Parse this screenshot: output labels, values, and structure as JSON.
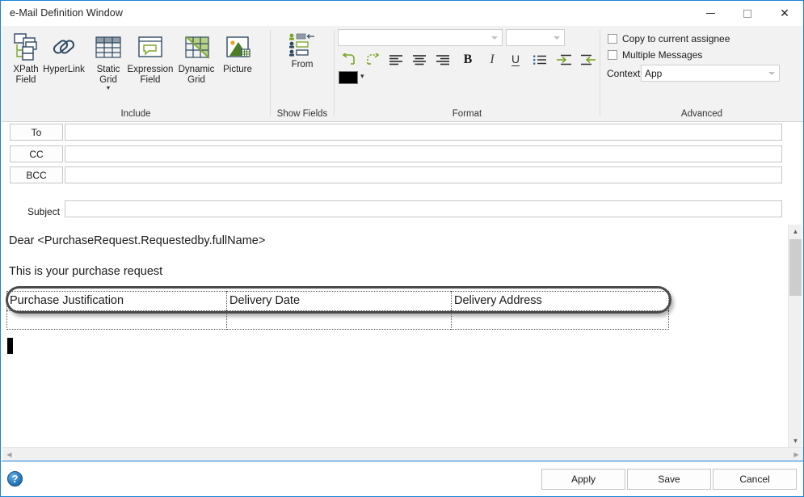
{
  "window": {
    "title": "e-Mail Definition Window",
    "controls": {
      "minimize": "minimize-button",
      "maximize": "maximize-button",
      "close": "close-button",
      "close_glyph": "✕"
    }
  },
  "ribbon": {
    "groups": [
      {
        "key": "include",
        "label": "Include"
      },
      {
        "key": "show_fields",
        "label": "Show Fields"
      },
      {
        "key": "format",
        "label": "Format"
      },
      {
        "key": "advanced",
        "label": "Advanced"
      }
    ],
    "include": {
      "buttons": [
        {
          "icon": "xpath-field-icon",
          "line1": "XPath",
          "line2": "Field",
          "has_menu": false
        },
        {
          "icon": "hyperlink-icon",
          "line1": "HyperLink",
          "line2": "",
          "has_menu": false
        },
        {
          "icon": "static-grid-icon",
          "line1": "Static",
          "line2": "Grid",
          "has_menu": true
        },
        {
          "icon": "expression-field-icon",
          "line1": "Expression",
          "line2": "Field",
          "has_menu": false
        },
        {
          "icon": "dynamic-grid-icon",
          "line1": "Dynamic",
          "line2": "Grid",
          "has_menu": false
        },
        {
          "icon": "picture-icon",
          "line1": "Picture",
          "line2": "",
          "has_menu": false
        }
      ]
    },
    "show_fields": {
      "from": {
        "icon": "from-field-icon",
        "label": "From"
      }
    },
    "format": {
      "font_family": {
        "value": "",
        "placeholder": ""
      },
      "font_size": {
        "value": "",
        "placeholder": ""
      },
      "buttons": [
        {
          "name": "undo-button",
          "glyph": "↩"
        },
        {
          "name": "redo-button",
          "glyph": "↪"
        },
        {
          "name": "align-left-button",
          "glyph": "align-left-icon"
        },
        {
          "name": "align-center-button",
          "glyph": "align-center-icon"
        },
        {
          "name": "align-right-button",
          "glyph": "align-right-icon"
        },
        {
          "name": "bold-button",
          "glyph": "B"
        },
        {
          "name": "italic-button",
          "glyph": "I"
        },
        {
          "name": "underline-button",
          "glyph": "U"
        },
        {
          "name": "bullet-list-button",
          "glyph": "bullet-list-icon"
        },
        {
          "name": "indent-increase-button",
          "glyph": "indent-increase-icon"
        },
        {
          "name": "indent-decrease-button",
          "glyph": "indent-decrease-icon"
        }
      ],
      "color_swatch": "#000000",
      "color_dropdown_glyph": "▾"
    },
    "advanced": {
      "copy_to_assignee": {
        "label": "Copy to current assignee",
        "checked": false
      },
      "multiple_messages": {
        "label": "Multiple Messages",
        "checked": false
      },
      "context": {
        "label": "Context",
        "value": "App"
      }
    }
  },
  "address": {
    "to": {
      "button": "To",
      "value": ""
    },
    "cc": {
      "button": "CC",
      "value": ""
    },
    "bcc": {
      "button": "BCC",
      "value": ""
    },
    "subject": {
      "label": "Subject",
      "value": ""
    }
  },
  "body": {
    "lines": [
      "Dear <PurchaseRequest.Requestedby.fullName>",
      "This is your purchase request"
    ],
    "grid": {
      "headers": [
        "Purchase Justification",
        "Delivery Date",
        "Delivery Address"
      ],
      "rows": [
        [
          "",
          "",
          ""
        ]
      ],
      "highlighted": true
    }
  },
  "footer": {
    "help": "?",
    "buttons": [
      {
        "name": "apply-button",
        "label": "Apply"
      },
      {
        "name": "save-button",
        "label": "Save"
      },
      {
        "name": "cancel-button",
        "label": "Cancel"
      }
    ]
  },
  "colors": {
    "accent": "#1883d7",
    "ribbon_bg": "#f2f2f2",
    "icon_navy": "#2e4a62",
    "icon_green": "#7ba428"
  }
}
